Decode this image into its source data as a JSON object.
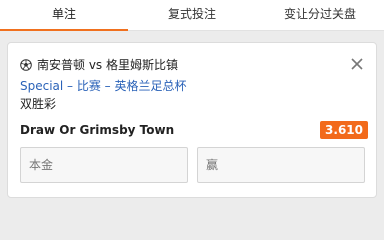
{
  "tabs": [
    {
      "label": "单注",
      "active": true
    },
    {
      "label": "复式投注",
      "active": false
    },
    {
      "label": "变让分过关盘",
      "active": false
    }
  ],
  "bet": {
    "event_title": "南安普顿 vs 格里姆斯比镇",
    "market": "Special – 比赛 – 英格兰足总杯",
    "bet_type": "双胜彩",
    "selection": "Draw Or Grimsby Town",
    "odds": "3.610",
    "stake_placeholder": "本金",
    "win_placeholder": "赢"
  },
  "colors": {
    "accent": "#f0701e",
    "odds_badge": "#f26a1b",
    "market_text": "#2a62b8"
  },
  "icons": {
    "sport": "soccer-ball-icon",
    "close": "close-icon"
  }
}
